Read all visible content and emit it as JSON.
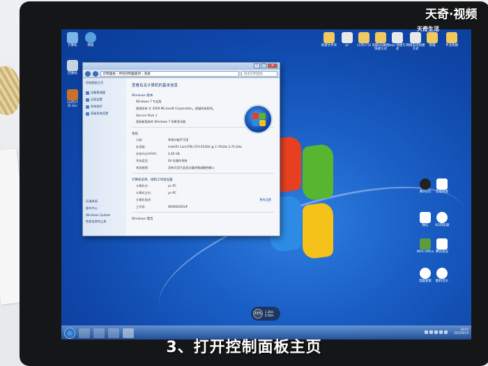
{
  "caption": "3、打开控制面板主页",
  "watermark": {
    "brand": "天奇·视频",
    "sub": "天奇生活"
  },
  "window": {
    "address": "控制面板 › 所有控制面板项 › 系统",
    "search_placeholder": "搜索控制面板",
    "sidebar": {
      "title": "控制面板主页",
      "links": [
        "设备管理器",
        "远程设置",
        "系统保护",
        "高级系统设置"
      ],
      "see_also_title": "另请参阅",
      "see_also": [
        "操作中心",
        "Windows Update",
        "性能信息和工具"
      ]
    },
    "main": {
      "title": "查看有关计算机的基本信息",
      "edition_section": "Windows 版本",
      "edition": "Windows 7 专业版",
      "copyright": "版权所有 © 2009 Microsoft Corporation。保留所有权利。",
      "service_pack": "Service Pack 1",
      "get_more": "获取新版本的 Windows 7 的更多功能",
      "system_section": "系统",
      "system_rows": [
        {
          "k": "分级:",
          "v": "系统分级不可用"
        },
        {
          "k": "处理器:",
          "v": "Intel(R) Core(TM) CPU   E5400 @ 2.70GHz   2.70 GHz"
        },
        {
          "k": "安装内存(RAM):",
          "v": "4.00 GB"
        },
        {
          "k": "系统类型:",
          "v": "64 位操作系统"
        },
        {
          "k": "笔和触摸:",
          "v": "没有可用于此显示器的笔或触控输入"
        }
      ],
      "computer_section": "计算机名称、域和工作组设置",
      "change_settings": "更改设置",
      "computer_rows": [
        {
          "k": "计算机名:",
          "v": "pc-PC"
        },
        {
          "k": "计算机全名:",
          "v": "pc-PC"
        },
        {
          "k": "计算机描述:",
          "v": ""
        },
        {
          "k": "工作组:",
          "v": "WORKGROUP"
        }
      ],
      "activation_section": "Windows 激活"
    }
  },
  "desktop_icons_left": [
    {
      "label": "计算机"
    },
    {
      "label": "网络"
    },
    {
      "label": "回收站"
    },
    {
      "label": "12月27日.doc"
    }
  ],
  "desktop_icons_top": [
    {
      "label": "新建文件夹"
    },
    {
      "label": "pc"
    },
    {
      "label": "12月27日"
    },
    {
      "label": "电脑QQ截图快捷方式"
    },
    {
      "label": "wps 快捷方式"
    },
    {
      "label": "网络电话快捷方式"
    },
    {
      "label": "管理"
    },
    {
      "label": "专业快捷"
    }
  ],
  "desktop_icons_right": [
    {
      "label": "腾讯QQ"
    },
    {
      "label": "百度网盘"
    },
    {
      "label": "微信"
    },
    {
      "label": "QQ浏览器"
    },
    {
      "label": "WPS Office"
    },
    {
      "label": "腾讯会议"
    },
    {
      "label": "电脑管家"
    },
    {
      "label": "酷狗音乐"
    }
  ],
  "taskbar": {
    "time": "19:52",
    "date": "2022/9/14",
    "speed_percent": "33%",
    "speed_up": "1.2K/s",
    "speed_down": "0.5K/s"
  },
  "colors": {
    "desktop_blue": "#1a5fc6",
    "window_title": "#aac4e6",
    "link_blue": "#2060b8"
  }
}
